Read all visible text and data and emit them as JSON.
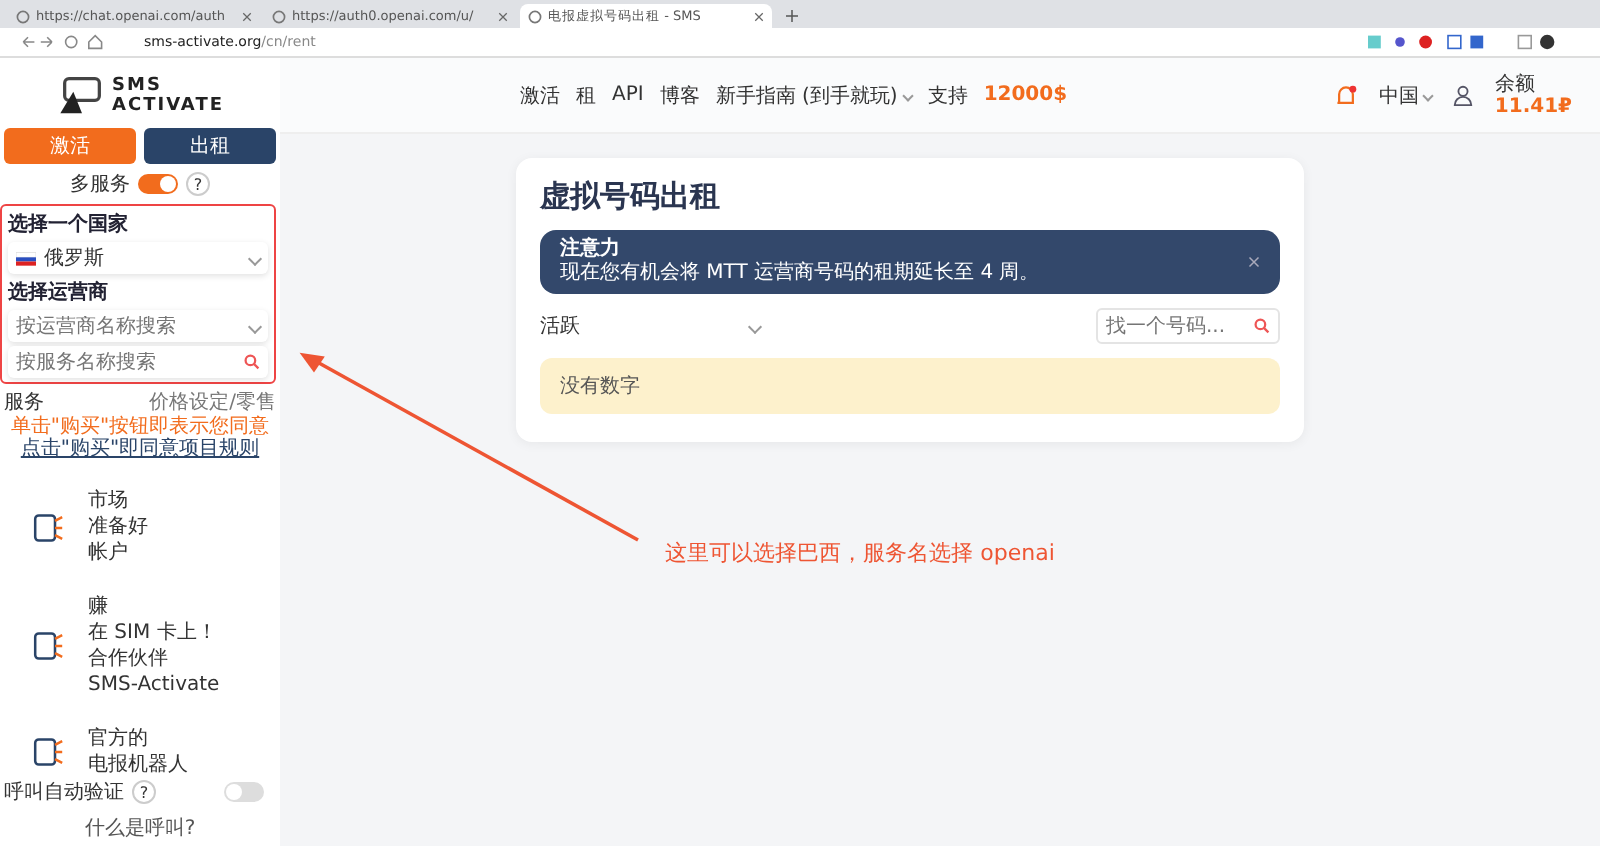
{
  "browser": {
    "tabs": [
      {
        "title": "https://chat.openai.com/auth",
        "selected": false
      },
      {
        "title": "https://auth0.openai.com/u/",
        "selected": false
      },
      {
        "title": "电报虚拟号码出租 - SMS",
        "selected": true
      }
    ],
    "address_host": "sms-activate.org",
    "address_path": "/cn/rent"
  },
  "sidebar": {
    "logo_top": "SMS",
    "logo_bottom": "ACTIVATE",
    "mode_buttons": [
      {
        "label": "激活",
        "color": "#f26c1d"
      },
      {
        "label": "出租",
        "color": "#2a4468"
      }
    ],
    "multi_service": {
      "label": "多服务",
      "on": true,
      "help": "?"
    },
    "country_label": "选择一个国家",
    "country_value": "俄罗斯",
    "operator_label": "选择运营商",
    "operator_placeholder": "按运营商名称搜索",
    "service_placeholder": "按服务名称搜索",
    "services_header": "服务",
    "price_header": "价格设定/零售",
    "notice": "单击\"购买\"按钮即表示您同意",
    "notice_link": "点击\"购买\"即同意项目规则",
    "promos": [
      {
        "lines": [
          "市场",
          "准备好",
          "帐户"
        ]
      },
      {
        "lines": [
          "赚",
          "在 SIM 卡上！",
          "合作伙伴",
          "SMS-Activate"
        ]
      },
      {
        "lines": [
          "官方的",
          "电报机器人"
        ]
      }
    ],
    "call_verify": {
      "label": "呼叫自动验证",
      "help": "?",
      "on": false
    },
    "call_link": "什么是呼叫?"
  },
  "topnav": {
    "links": [
      {
        "label": "激活",
        "dropdown": false
      },
      {
        "label": "租",
        "dropdown": false
      },
      {
        "label": "API",
        "dropdown": false
      },
      {
        "label": "博客",
        "dropdown": false
      },
      {
        "label": "新手指南 (到手就玩)",
        "dropdown": true
      },
      {
        "label": "支持",
        "dropdown": false
      }
    ],
    "bonus": "12000$",
    "language": "中国",
    "balance_label": "余额",
    "balance": "11.41₽"
  },
  "main": {
    "title": "虚拟号码出租",
    "alert": {
      "title": "注意力",
      "text": "现在您有机会将 MTT 运营商号码的租期延长至 4 周。"
    },
    "status_select": "活跃",
    "search_placeholder": "找一个号码...",
    "empty": "没有数字"
  },
  "annotation": "这里可以选择巴西，服务名选择 openai"
}
